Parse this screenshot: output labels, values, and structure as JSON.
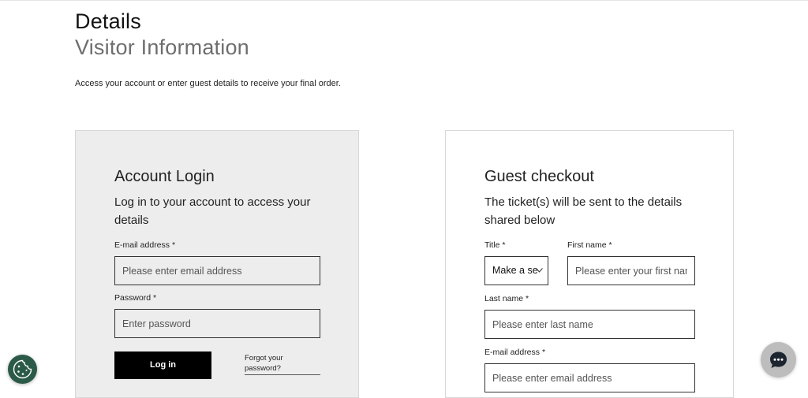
{
  "header": {
    "title": "Details",
    "subtitle": "Visitor Information",
    "intro": "Access your account or enter guest details to receive your final order."
  },
  "login": {
    "title": "Account Login",
    "subtitle": "Log in to your account to access your details",
    "email_label": "E-mail address *",
    "email_placeholder": "Please enter email address",
    "password_label": "Password *",
    "password_placeholder": "Enter password",
    "login_button": "Log in",
    "forgot_link": "Forgot your password?"
  },
  "guest": {
    "title": "Guest checkout",
    "subtitle": "The ticket(s) will be sent to the details shared below",
    "title_label": "Title *",
    "title_select_value": "Make a se",
    "first_name_label": "First name *",
    "first_name_placeholder": "Please enter your first name",
    "last_name_label": "Last name *",
    "last_name_placeholder": "Please enter last name",
    "email_label": "E-mail address *",
    "email_placeholder": "Please enter email address"
  },
  "widgets": {
    "cookie_icon": "cookie-icon",
    "chat_icon": "chat-bubble-icon"
  },
  "colors": {
    "login_button_bg": "#000000",
    "cookie_button_bg": "#2c5a48",
    "chat_button_bg": "#bdbdbd",
    "login_panel_bg": "#ededed"
  }
}
